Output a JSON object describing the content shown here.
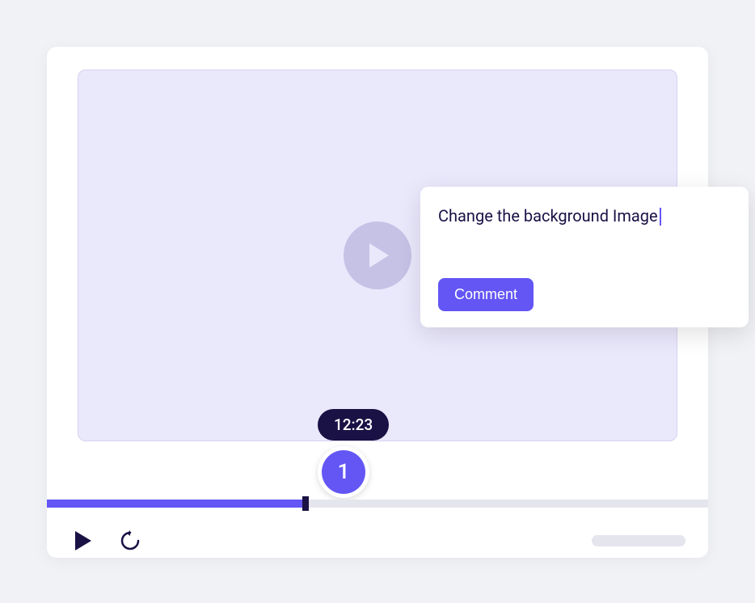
{
  "player": {
    "timestamp": "12:23",
    "marker_number": "1"
  },
  "comment_popup": {
    "text": "Change the background Image",
    "button_label": "Comment"
  }
}
